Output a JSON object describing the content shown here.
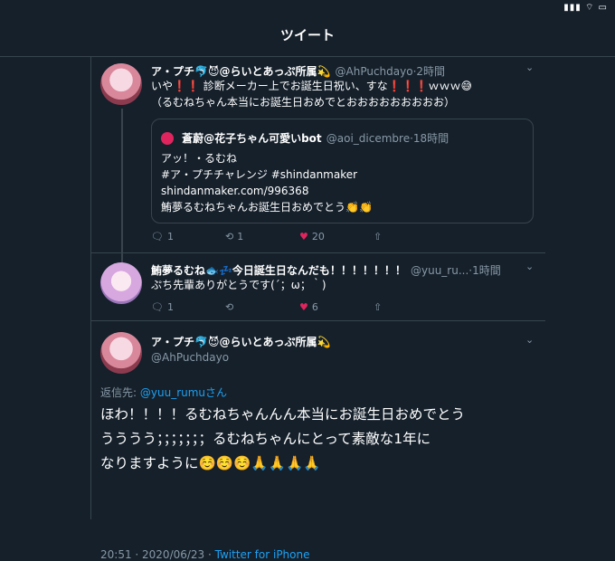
{
  "status": {
    "icons": "▮▮▮ ⌔ ▭"
  },
  "header": {
    "title": "ツイート"
  },
  "tweet1": {
    "name": "ア・プチ🐬😈@らいとあっぷ所属💫",
    "handle": "@AhPuchdayo",
    "time": "·2時間",
    "text1": "いや❗❗ 診断メーカー上でお誕生日祝い、すな❗❗❗ｗｗｗ😅",
    "text2": "（るむねちゃん本当にお誕生日おめでとおおおおおおおおお）",
    "quote": {
      "name": "蒼蔚@花子ちゃん可愛いbot",
      "handle": "@aoi_dicembre",
      "time": "·18時間",
      "line1": "アッ！・るむね",
      "line2": "#ア・プチチャレンジ #shindanmaker",
      "line3": "shindanmaker.com/996368",
      "line4": "鮪夢るむねちゃんお誕生日おめでとう👏👏"
    },
    "replies": "1",
    "retweets": "1",
    "likes": "20"
  },
  "tweet2": {
    "name": "鮪夢るむね🐟💤今日誕生日なんだも！！！！！！！",
    "handle": "@yuu_ru...",
    "time": "·1時間",
    "text": "ぷち先輩ありがとうです(´；ω；｀)",
    "replies": "1",
    "likes": "6"
  },
  "main": {
    "name": "ア・プチ🐬😈@らいとあっぷ所属💫",
    "handle": "@AhPuchdayo",
    "reply_label": "返信先:",
    "reply_to": "@yuu_rumuさん",
    "body1": "ほわ！！！！るむねちゃんんん本当にお誕生日おめでとう",
    "body2": "うううう；；；；；；；るむねちゃんにとって素敵な1年に",
    "body3": "なりますように☺️☺️☺️🙏🙏🙏🙏",
    "timestamp": "20:51 · 2020/06/23 · ",
    "client": "Twitter for iPhone"
  },
  "colors": {
    "bg": "#15202b",
    "border": "#38444d",
    "muted": "#8899a6",
    "link": "#1da1f2",
    "like": "#e0245e"
  }
}
